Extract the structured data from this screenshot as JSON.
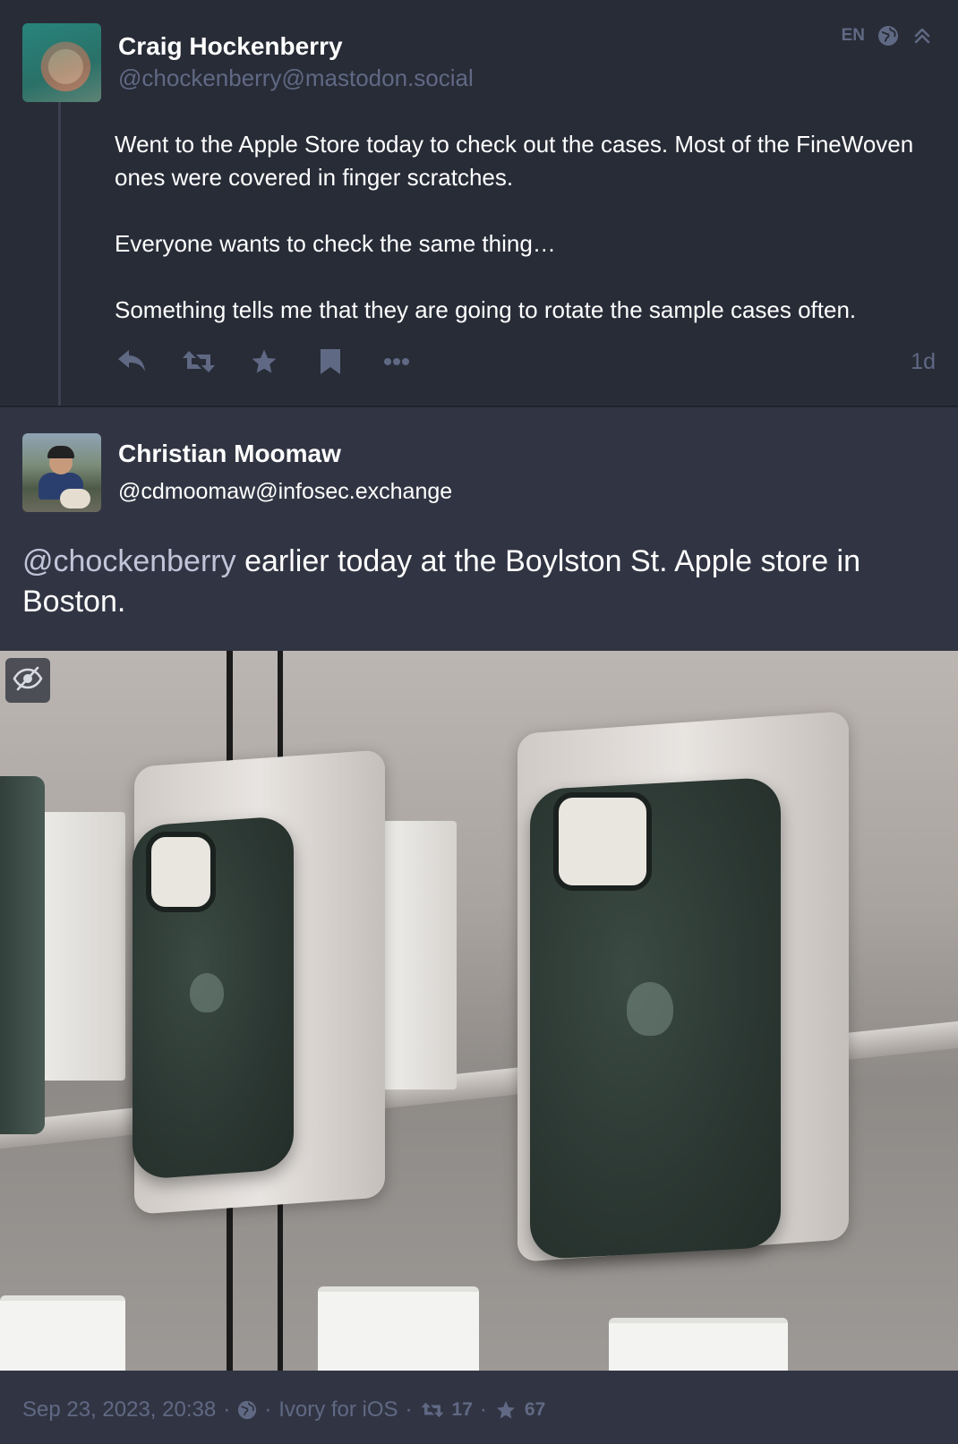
{
  "post1": {
    "author_name": "Craig Hockenberry",
    "author_handle": "@chockenberry@mastodon.social",
    "language": "EN",
    "visibility_icon": "globe-icon",
    "collapse_icon": "chevron-double-up-icon",
    "paragraphs": [
      "Went to the Apple Store today to check out the cases. Most of the FineWoven ones were covered in finger scratches.",
      "Everyone wants to check the same thing…",
      "Something tells me that they are going to rotate the sample cases often."
    ],
    "actions": [
      "reply-icon",
      "boost-icon",
      "favourite-icon",
      "bookmark-icon",
      "more-icon"
    ],
    "relative_time": "1d"
  },
  "post2": {
    "author_name": "Christian Moomaw",
    "author_handle": "@cdmoomaw@infosec.exchange",
    "mention": "@chockenberry",
    "text": " earlier today at the Boylston St. Apple store in Boston.",
    "media_toggle_icon": "eye-slash-icon"
  },
  "footer": {
    "datetime": "Sep 23, 2023, 20:38",
    "visibility_icon": "globe-icon",
    "app": "Ivory for iOS",
    "boosts": "17",
    "favourites": "67"
  },
  "colors": {
    "background": "#282c37",
    "focused_background": "#313543",
    "muted_text": "#606984",
    "mention": "#c0c5d9"
  }
}
